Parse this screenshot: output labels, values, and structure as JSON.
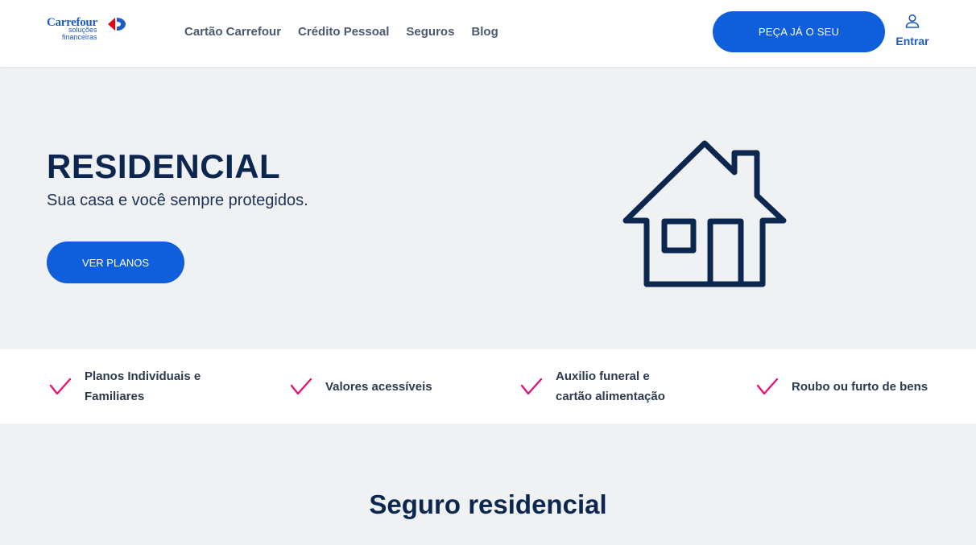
{
  "brand": {
    "name": "Carrefour",
    "sub_line1": "soluções",
    "sub_line2": "financeiras",
    "color": "#1e5bc6"
  },
  "nav": {
    "items": [
      {
        "label": "Cartão Carrefour"
      },
      {
        "label": "Crédito Pessoal"
      },
      {
        "label": "Seguros"
      },
      {
        "label": "Blog"
      }
    ]
  },
  "header": {
    "cta_label": "PEÇA JÁ O SEU",
    "login_label": "Entrar",
    "login_icon": "user-icon"
  },
  "hero": {
    "title": "RESIDENCIAL",
    "subtitle": "Sua casa e você sempre protegidos.",
    "cta_label": "VER PLANOS",
    "illustration": "house-icon"
  },
  "features": {
    "check_icon": "checkmark-icon",
    "check_color": "#e0167a",
    "items": [
      {
        "label": "Planos Individuais e Familiares"
      },
      {
        "label": "Valores acessíveis"
      },
      {
        "label": "Auxilio funeral e cartão alimentação"
      },
      {
        "label": "Roubo ou furto de bens"
      }
    ]
  },
  "section": {
    "title": "Seguro residencial"
  },
  "colors": {
    "primary": "#0f5fdc",
    "navy": "#0b2750",
    "background": "#f0f1f3"
  }
}
